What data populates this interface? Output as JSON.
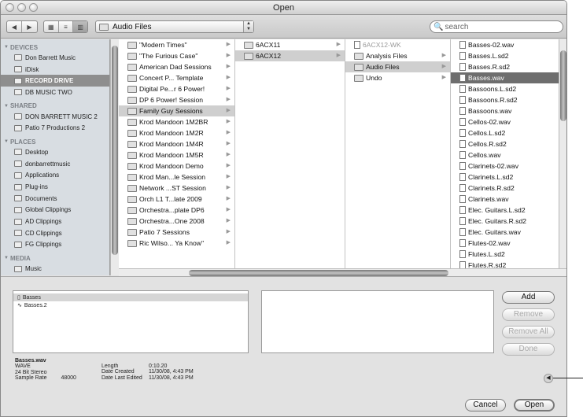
{
  "window": {
    "title": "Open"
  },
  "toolbar": {
    "path": "Audio Files",
    "search_placeholder": "search"
  },
  "sidebar": {
    "sections": [
      {
        "title": "DEVICES",
        "items": [
          {
            "label": "Don Barrett Music",
            "icon": "hard-drive-icon"
          },
          {
            "label": "iDisk",
            "icon": "idisk-icon"
          },
          {
            "label": "RECORD DRIVE",
            "icon": "hard-drive-icon",
            "selected": true
          },
          {
            "label": "DB MUSIC TWO",
            "icon": "hard-drive-icon"
          }
        ]
      },
      {
        "title": "SHARED",
        "items": [
          {
            "label": "DON BARRETT MUSIC 2",
            "icon": "computer-icon"
          },
          {
            "label": "Patio 7 Productions 2",
            "icon": "network-icon"
          }
        ]
      },
      {
        "title": "PLACES",
        "items": [
          {
            "label": "Desktop",
            "icon": "desktop-icon"
          },
          {
            "label": "donbarrettmusic",
            "icon": "home-icon"
          },
          {
            "label": "Applications",
            "icon": "applications-icon"
          },
          {
            "label": "Plug-ins",
            "icon": "folder-icon"
          },
          {
            "label": "Documents",
            "icon": "folder-icon"
          },
          {
            "label": "Global Clippings",
            "icon": "folder-icon"
          },
          {
            "label": "AD Clippings",
            "icon": "disc-icon"
          },
          {
            "label": "CD Clippings",
            "icon": "disc-icon"
          },
          {
            "label": "FG Clippings",
            "icon": "disc-icon"
          }
        ]
      },
      {
        "title": "MEDIA",
        "items": [
          {
            "label": "Music",
            "icon": "music-icon"
          }
        ]
      }
    ]
  },
  "columns": [
    {
      "items": [
        {
          "label": "\"Modern Times\"",
          "folder": true
        },
        {
          "label": "\"The Furious Case\"",
          "folder": true
        },
        {
          "label": "American Dad Sessions",
          "folder": true
        },
        {
          "label": "Concert P... Template",
          "folder": true
        },
        {
          "label": "Digital Pe...r 6 Power!",
          "folder": true
        },
        {
          "label": "DP 6 Power! Session",
          "folder": true
        },
        {
          "label": "Family Guy Sessions",
          "folder": true,
          "selected": true
        },
        {
          "label": "Krod Mandoon 1M2BR",
          "folder": true
        },
        {
          "label": "Krod Mandoon 1M2R",
          "folder": true
        },
        {
          "label": "Krod Mandoon 1M4R",
          "folder": true
        },
        {
          "label": "Krod Mandoon 1M5R",
          "folder": true
        },
        {
          "label": "Krod Mandoon Demo",
          "folder": true
        },
        {
          "label": "Krod Man...le Session",
          "folder": true
        },
        {
          "label": "Network ...ST Session",
          "folder": true
        },
        {
          "label": "Orch L1 T...late 2009",
          "folder": true
        },
        {
          "label": "Orchestra...plate DP6",
          "folder": true
        },
        {
          "label": "Orchestra...One 2008",
          "folder": true
        },
        {
          "label": "Patio 7 Sessions",
          "folder": true
        },
        {
          "label": "Ric Wilso... Ya Know\"",
          "folder": true
        }
      ]
    },
    {
      "items": [
        {
          "label": "6ACX11",
          "folder": true
        },
        {
          "label": "6ACX12",
          "folder": true,
          "selected": true
        }
      ]
    },
    {
      "items": [
        {
          "label": "6ACX12-WK",
          "folder": false,
          "dim": true
        },
        {
          "label": "Analysis Files",
          "folder": true
        },
        {
          "label": "Audio Files",
          "folder": true,
          "selected": true
        },
        {
          "label": "Undo",
          "folder": true
        }
      ]
    },
    {
      "items": [
        {
          "label": "Basses-02.wav"
        },
        {
          "label": "Basses.L.sd2"
        },
        {
          "label": "Basses.R.sd2"
        },
        {
          "label": "Basses.wav",
          "highlight": true
        },
        {
          "label": "Bassoons.L.sd2"
        },
        {
          "label": "Bassoons.R.sd2"
        },
        {
          "label": "Bassoons.wav"
        },
        {
          "label": "Cellos-02.wav"
        },
        {
          "label": "Cellos.L.sd2"
        },
        {
          "label": "Cellos.R.sd2"
        },
        {
          "label": "Cellos.wav"
        },
        {
          "label": "Clarinets-02.wav"
        },
        {
          "label": "Clarinets.L.sd2"
        },
        {
          "label": "Clarinets.R.sd2"
        },
        {
          "label": "Clarinets.wav"
        },
        {
          "label": "Elec. Guitars.L.sd2"
        },
        {
          "label": "Elec. Guitars.R.sd2"
        },
        {
          "label": "Elec. Guitars.wav"
        },
        {
          "label": "Flutes-02.wav"
        },
        {
          "label": "Flutes.L.sd2"
        },
        {
          "label": "Flutes.R.sd2"
        }
      ]
    }
  ],
  "selection_list": [
    "Basses",
    "Basses.2"
  ],
  "buttons": {
    "add": "Add",
    "remove": "Remove",
    "remove_all": "Remove All",
    "done": "Done",
    "cancel": "Cancel",
    "open": "Open"
  },
  "file_info": {
    "name": "Basses.wav",
    "format": "WAVE",
    "bit_depth": "24 Bit Stereo",
    "sample_rate_label": "Sample Rate",
    "sample_rate": "48000",
    "length_label": "Length",
    "length": "0:10.20",
    "created_label": "Date Created",
    "created": "11/30/08, 4:43 PM",
    "modified_label": "Date Last Edited",
    "modified": "11/30/08, 4:43 PM"
  }
}
